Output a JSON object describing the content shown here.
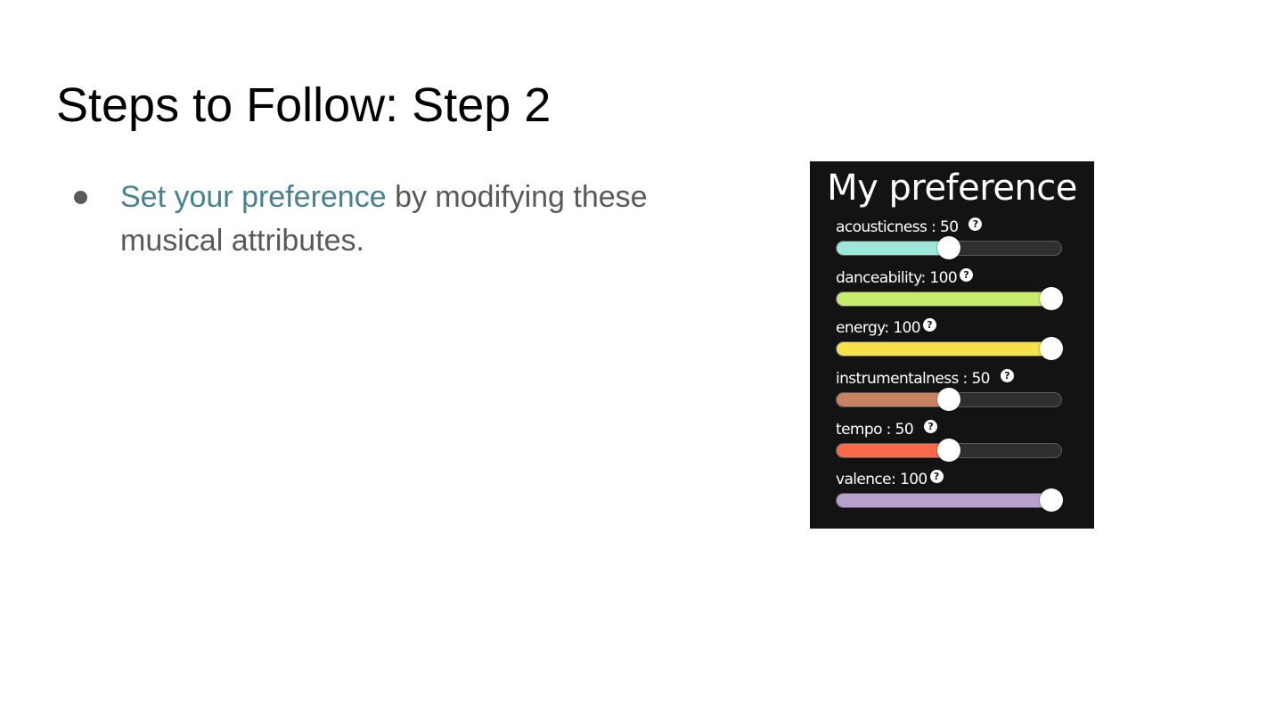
{
  "slide": {
    "title": "Steps to Follow: Step 2",
    "bullet": {
      "link_text": "Set your preference",
      "rest_text": " by modifying these musical attributes."
    }
  },
  "preference_panel": {
    "title": "My preference",
    "help_icon_glyph": "?",
    "sliders": [
      {
        "label": "acousticness : 50",
        "value": 50,
        "max": 100,
        "color": "#9fe6da"
      },
      {
        "label": "danceability: 100",
        "value": 100,
        "max": 100,
        "color": "#c8ec6c"
      },
      {
        "label": "energy: 100",
        "value": 100,
        "max": 100,
        "color": "#f6e04c"
      },
      {
        "label": "instrumentalness : 50",
        "value": 50,
        "max": 100,
        "color": "#c98262"
      },
      {
        "label": "tempo : 50",
        "value": 50,
        "max": 100,
        "color": "#fb6a48"
      },
      {
        "label": "valence: 100",
        "value": 100,
        "max": 100,
        "color": "#b8a0ce"
      }
    ]
  },
  "colors": {
    "link": "#45818e",
    "body_text": "#595959",
    "panel_background": "#131313"
  }
}
